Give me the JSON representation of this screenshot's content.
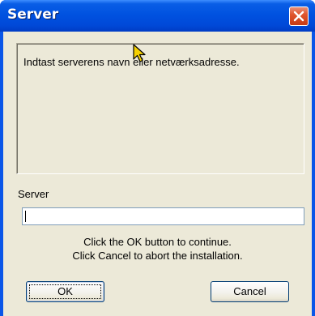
{
  "window": {
    "title": "Server",
    "close_icon": "close-icon"
  },
  "message": {
    "text": "Indtast serverens navn eller netværksadresse."
  },
  "server_field": {
    "label": "Server",
    "value": ""
  },
  "instructions": {
    "line1": "Click the OK button to continue.",
    "line2": "Click Cancel to abort the installation."
  },
  "buttons": {
    "ok": "OK",
    "cancel": "Cancel"
  },
  "colors": {
    "titlebar": "#0052e0",
    "client": "#ece9d8",
    "close_button": "#e0552e"
  }
}
